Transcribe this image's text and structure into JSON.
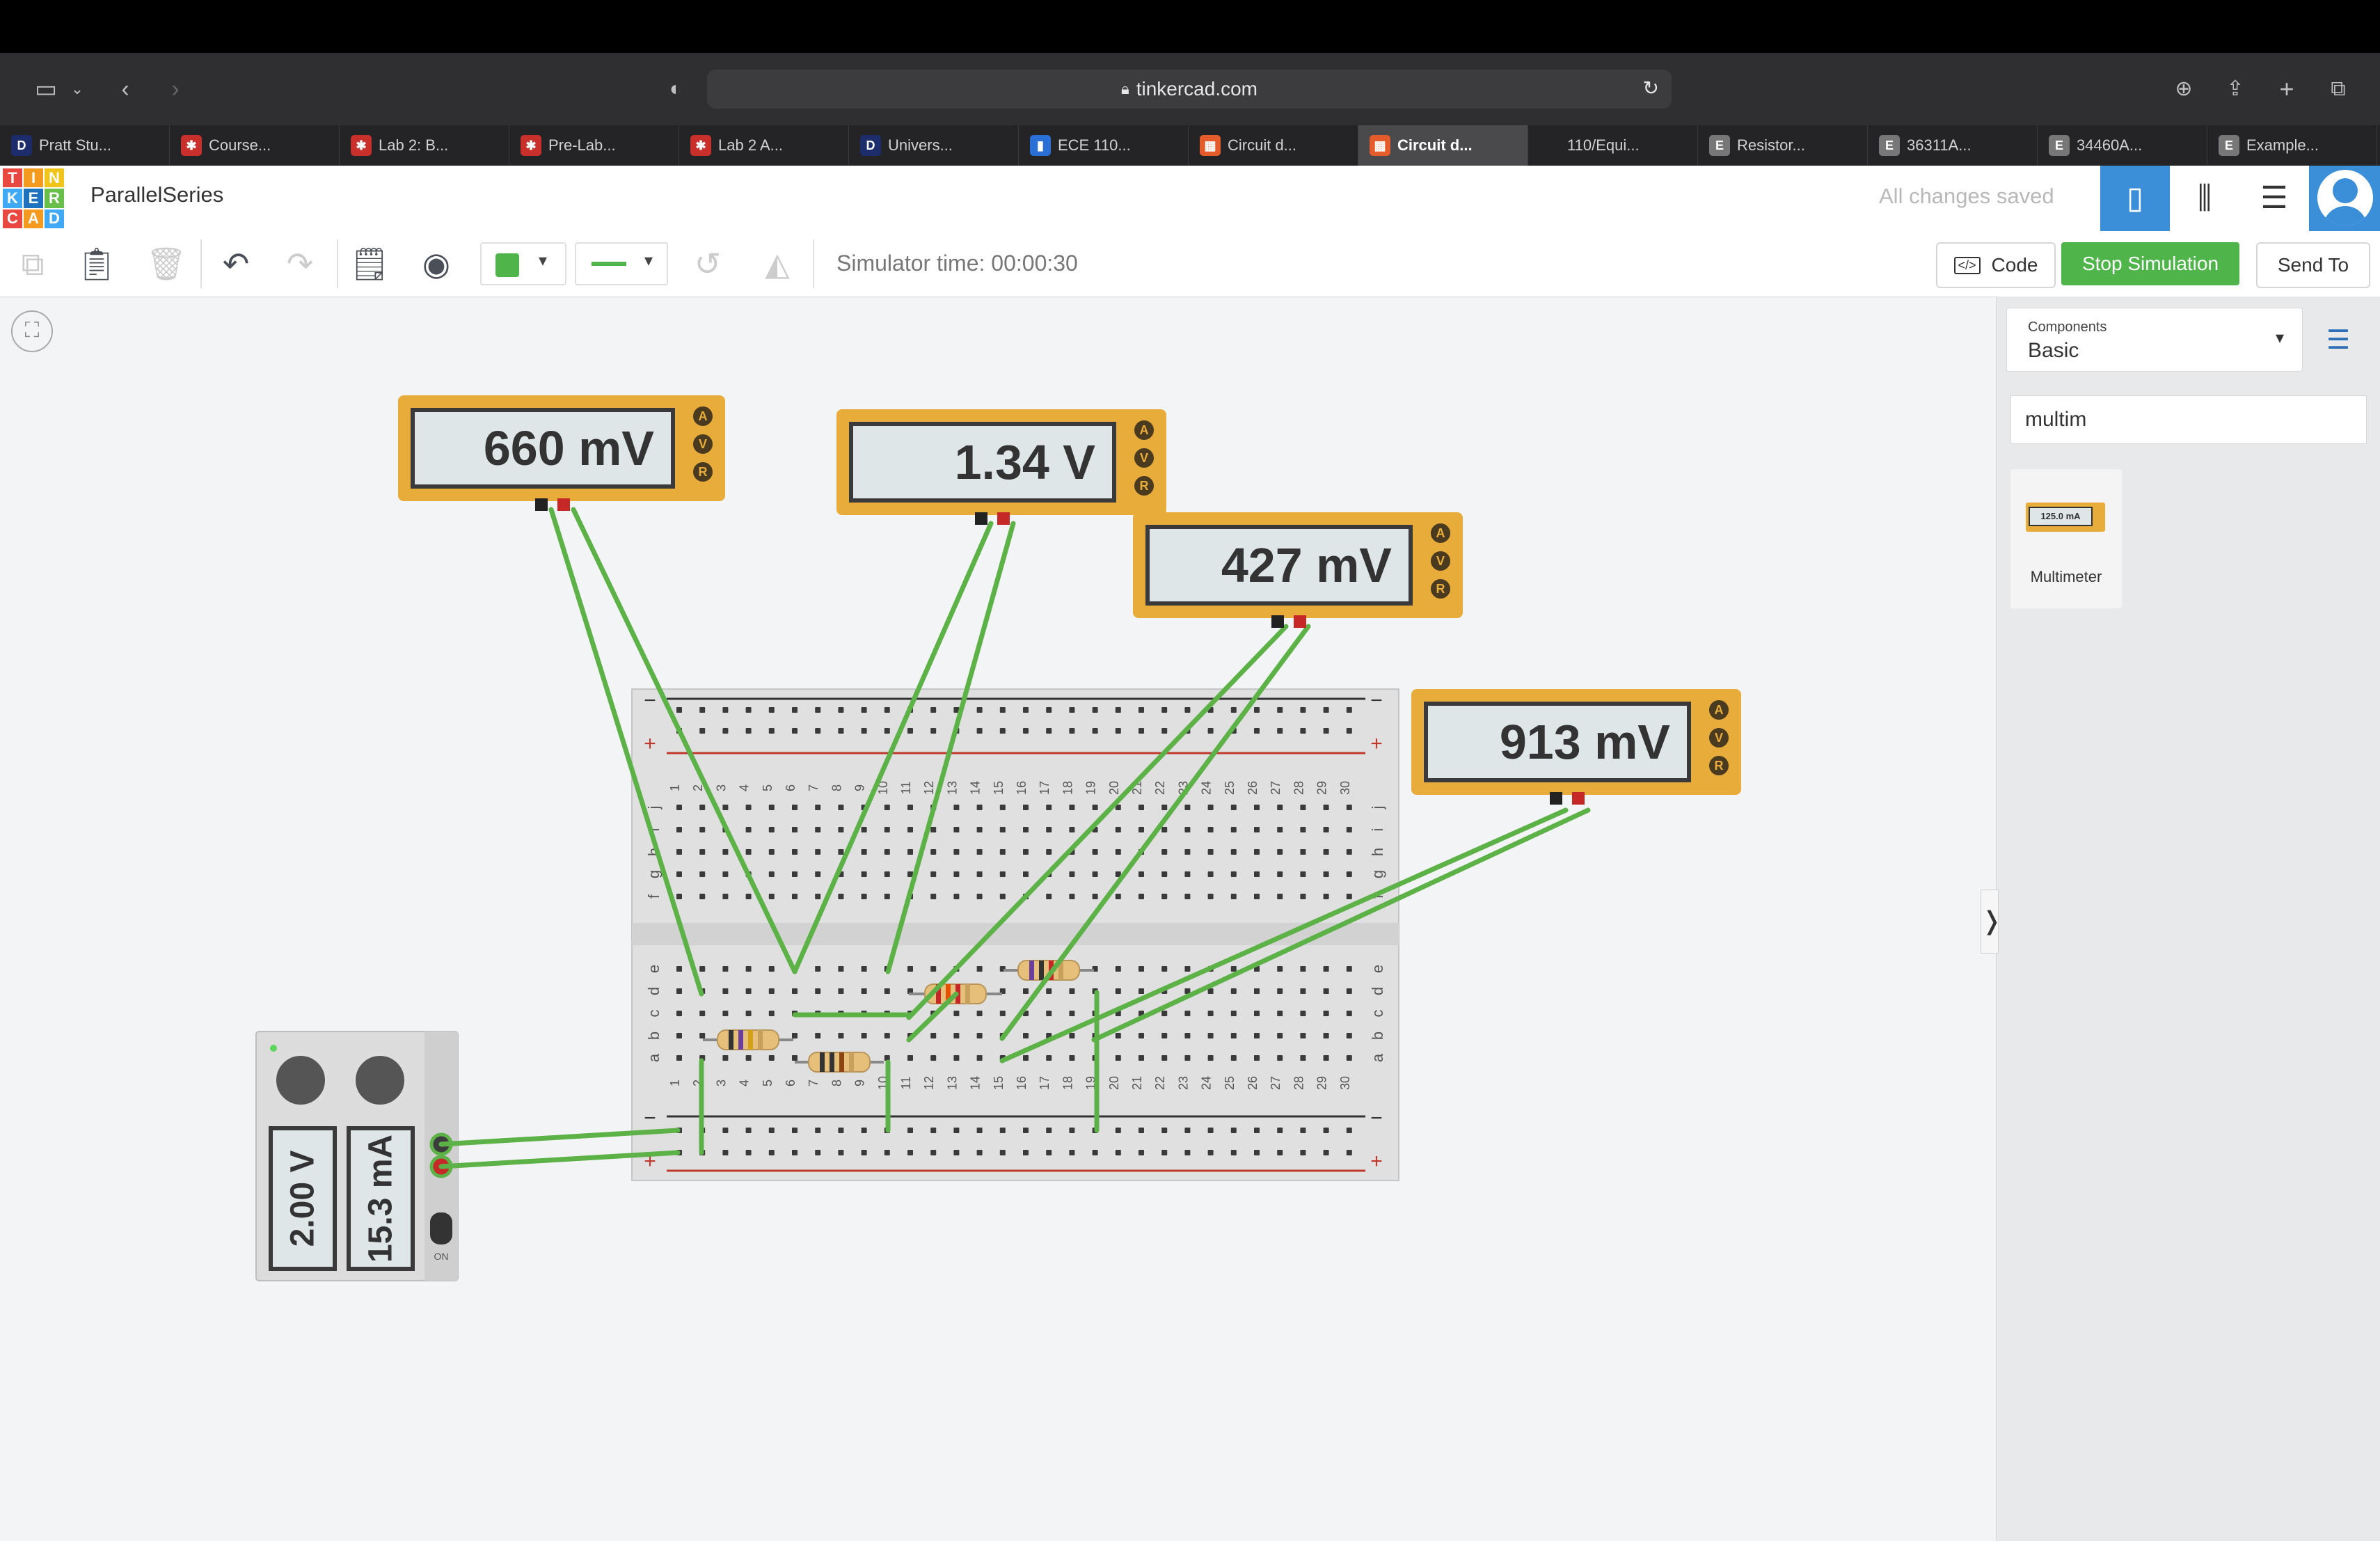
{
  "browser": {
    "url": "tinkercad.com",
    "tabs": [
      {
        "label": "Pratt Stu...",
        "icon": "D",
        "icon_bg": "#1d2d6b"
      },
      {
        "label": "Course...",
        "icon": "✱",
        "icon_bg": "#c9302c"
      },
      {
        "label": "Lab 2: B...",
        "icon": "✱",
        "icon_bg": "#c9302c"
      },
      {
        "label": "Pre-Lab...",
        "icon": "✱",
        "icon_bg": "#c9302c"
      },
      {
        "label": "Lab 2 A...",
        "icon": "✱",
        "icon_bg": "#c9302c"
      },
      {
        "label": "Univers...",
        "icon": "D",
        "icon_bg": "#1d2d6b"
      },
      {
        "label": "ECE 110...",
        "icon": "▮",
        "icon_bg": "#2a6fd6"
      },
      {
        "label": "Circuit d...",
        "icon": "▦",
        "icon_bg": "#e45c2b"
      },
      {
        "label": "Circuit d...",
        "icon": "▦",
        "icon_bg": "#e45c2b",
        "active": true
      },
      {
        "label": "110/Equi...",
        "icon": "",
        "icon_bg": "#242426"
      },
      {
        "label": "Resistor...",
        "icon": "E",
        "icon_bg": "#777"
      },
      {
        "label": "36311A...",
        "icon": "E",
        "icon_bg": "#777"
      },
      {
        "label": "34460A...",
        "icon": "E",
        "icon_bg": "#777"
      },
      {
        "label": "Example...",
        "icon": "E",
        "icon_bg": "#777"
      }
    ]
  },
  "app": {
    "logo_letters": [
      "T",
      "I",
      "N",
      "K",
      "E",
      "R",
      "C",
      "A",
      "D"
    ],
    "logo_colors": [
      "#e8483f",
      "#f39a1f",
      "#f0c419",
      "#3fa9f5",
      "#1e73be",
      "#68c04a",
      "#e8483f",
      "#f39a1f",
      "#3fa9f5"
    ],
    "project_name": "ParallelSeries",
    "save_status": "All changes saved"
  },
  "toolbar": {
    "simulator_time": "Simulator time: 00:00:30",
    "code_label": "Code",
    "stop_label": "Stop Simulation",
    "send_label": "Send To",
    "color_swatch": "#4fb54a"
  },
  "panel": {
    "components_caption": "Components",
    "components_value": "Basic",
    "search_value": "multim",
    "item_label": "Multimeter",
    "item_display": "125.0 mA"
  },
  "multimeters": [
    {
      "reading": "660 mV"
    },
    {
      "reading": "1.34 V"
    },
    {
      "reading": "427 mV"
    },
    {
      "reading": "913 mV"
    }
  ],
  "dial_labels": [
    "A",
    "V",
    "R"
  ],
  "power_supply": {
    "voltage": "2.00 V",
    "current": "15.3 mA",
    "on_label": "ON"
  },
  "breadboard": {
    "col_numbers": [
      "1",
      "2",
      "3",
      "4",
      "5",
      "6",
      "7",
      "8",
      "9",
      "10",
      "11",
      "12",
      "13",
      "14",
      "15",
      "16",
      "17",
      "18",
      "19",
      "20",
      "21",
      "22",
      "23",
      "24",
      "25",
      "26",
      "27",
      "28",
      "29",
      "30"
    ],
    "top_rows": [
      "j",
      "i",
      "h",
      "g",
      "f"
    ],
    "bottom_rows": [
      "e",
      "d",
      "c",
      "b",
      "a"
    ],
    "minus": "−",
    "plus": "+"
  },
  "colors": {
    "wire": "#5cb247",
    "accent_blue": "#3b8fd9",
    "stop_green": "#4fb54a",
    "meter_orange": "#e8ac3b"
  }
}
